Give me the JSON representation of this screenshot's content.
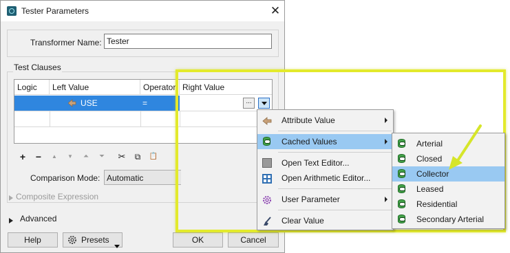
{
  "window": {
    "title": "Tester Parameters",
    "close_glyph": "✕"
  },
  "transformer": {
    "label": "Transformer Name:",
    "value": "Tester"
  },
  "clauses": {
    "group_label": "Test Clauses",
    "columns": [
      "Logic",
      "Left Value",
      "Operator",
      "Right Value"
    ],
    "rows": [
      {
        "logic": "",
        "left_value": "USE",
        "operator": "=",
        "right_value": ""
      }
    ],
    "ellipsis_label": "..."
  },
  "toolbar": {
    "add": "+",
    "remove": "−",
    "up": "▲",
    "down": "▼",
    "top": "⏶",
    "bottom": "⏷",
    "cut": "✂",
    "copy": "⧉",
    "paste": "📋"
  },
  "comparison": {
    "label": "Comparison Mode:",
    "value": "Automatic"
  },
  "composite": {
    "label": "Composite Expression"
  },
  "advanced": {
    "label": "Advanced"
  },
  "buttons": {
    "help": "Help",
    "presets": "Presets",
    "ok": "OK",
    "cancel": "Cancel"
  },
  "menu": {
    "items": [
      {
        "label": "Attribute Value",
        "icon": "attribute-icon",
        "submenu": true
      },
      {
        "label": "Cached Values",
        "icon": "database-icon",
        "submenu": true,
        "selected": true
      },
      {
        "label": "Open Text Editor...",
        "icon": "text-editor-icon"
      },
      {
        "label": "Open Arithmetic Editor...",
        "icon": "calculator-icon"
      },
      {
        "label": "User Parameter",
        "icon": "gear-icon",
        "submenu": true
      },
      {
        "label": "Clear Value",
        "icon": "broom-icon"
      }
    ]
  },
  "submenu": {
    "items": [
      {
        "label": "Arterial"
      },
      {
        "label": "Closed"
      },
      {
        "label": "Collector",
        "selected": true
      },
      {
        "label": "Leased"
      },
      {
        "label": "Residential"
      },
      {
        "label": "Secondary Arterial"
      }
    ]
  },
  "colors": {
    "selection": "#2f86df",
    "menu_highlight": "#99c9f2",
    "highlight_frame": "#e3ea2c",
    "arrow": "#d6e52a"
  }
}
